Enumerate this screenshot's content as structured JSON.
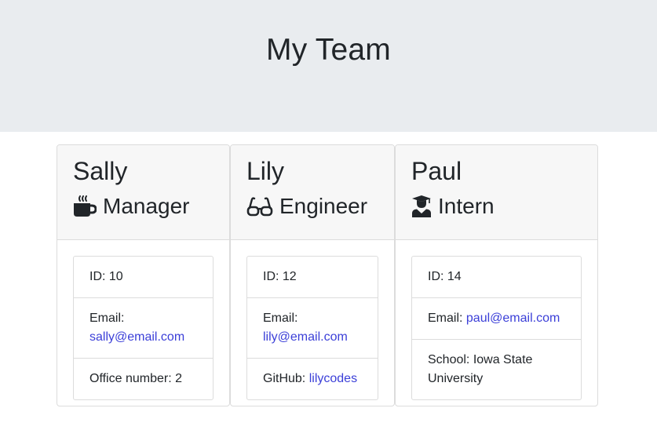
{
  "header": {
    "title": "My Team"
  },
  "colors": {
    "header_bg": "#e9ecef",
    "card_head_bg": "#f7f7f7",
    "link": "#3b3fd8"
  },
  "cards": [
    {
      "name": "Sally",
      "role": "Manager",
      "role_icon": "coffee-icon",
      "id_text": "ID: 10",
      "email_label": "Email:",
      "email": "sally@email.com",
      "extra_label": "Office number: 2"
    },
    {
      "name": "Lily",
      "role": "Engineer",
      "role_icon": "glasses-icon",
      "id_text": "ID: 12",
      "email_label": "Email:",
      "email": "lily@email.com",
      "extra_label": "GitHub:",
      "extra_link": "lilycodes"
    },
    {
      "name": "Paul",
      "role": "Intern",
      "role_icon": "graduate-icon",
      "id_text": "ID: 14",
      "email_label": "Email:",
      "email": "paul@email.com",
      "extra_label": "School: Iowa State University"
    }
  ]
}
